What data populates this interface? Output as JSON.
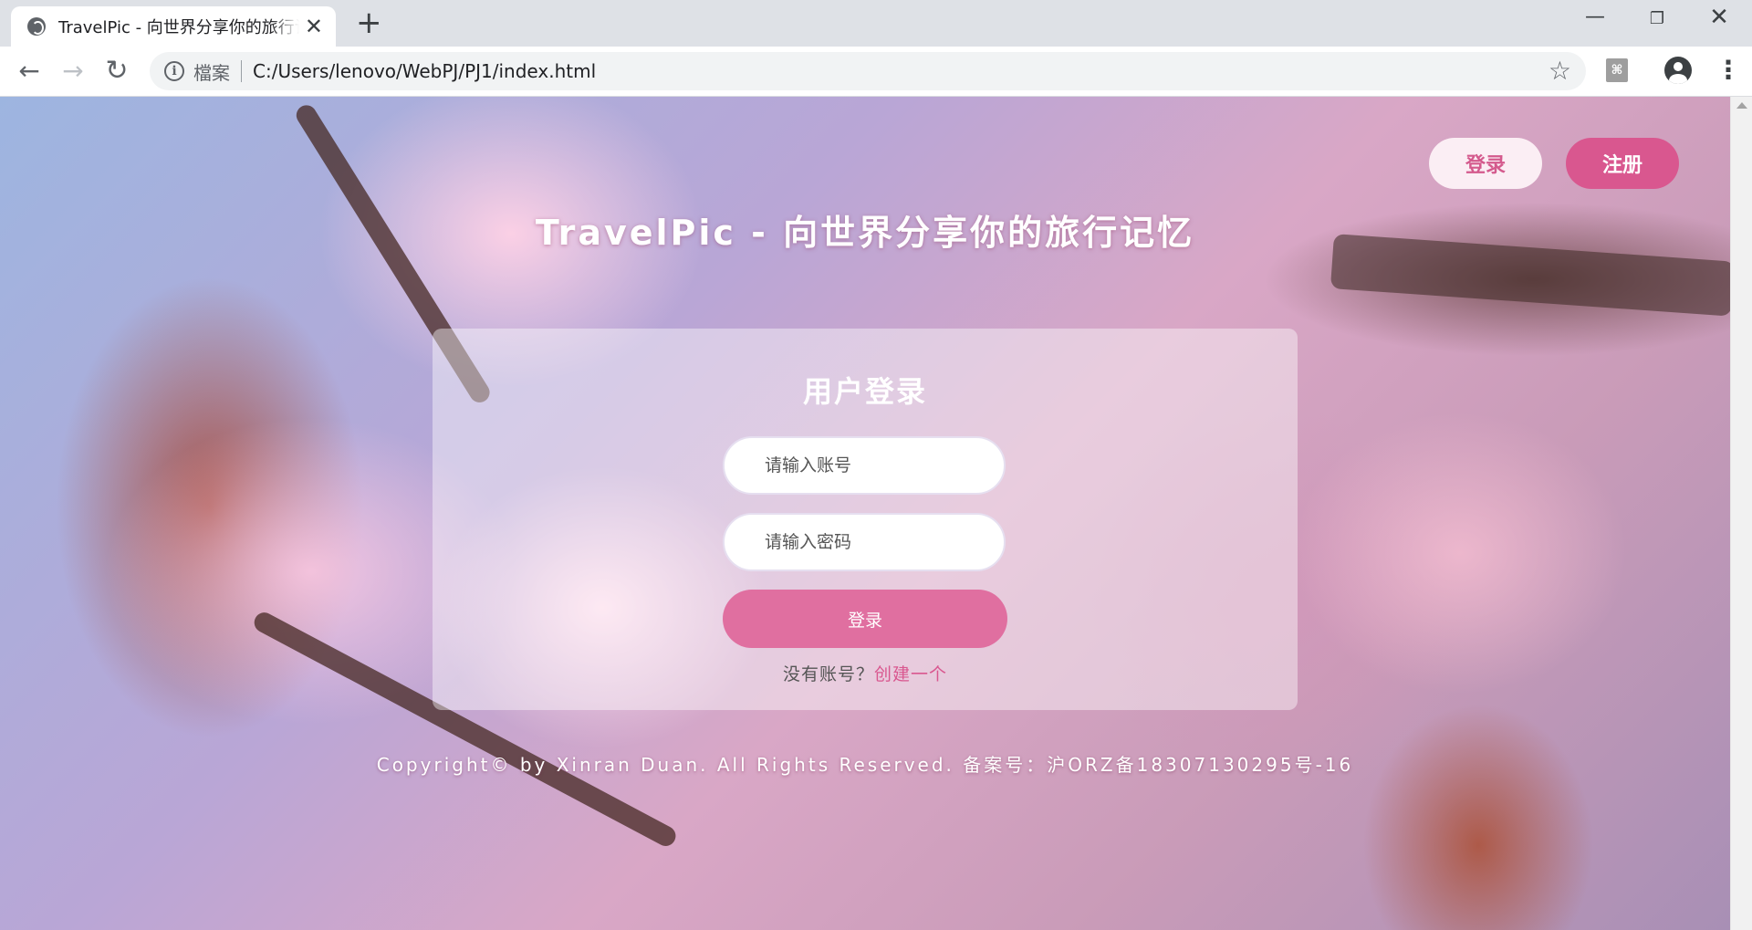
{
  "browser": {
    "tab_title": "TravelPic - 向世界分享你的旅行记忆",
    "tab_close": "✕",
    "new_tab": "+",
    "window_minimize": "—",
    "window_restore": "❐",
    "window_close": "✕",
    "back": "←",
    "forward": "→",
    "reload": "↻",
    "security_label": "檔案",
    "url": "C:/Users/lenovo/WebPJ/PJ1/index.html",
    "bookmark_star": "☆",
    "extension_icon": "pdf-extension-icon",
    "menu": "⋮"
  },
  "header": {
    "login_label": "登录",
    "register_label": "注册"
  },
  "site_title": "TravelPic - 向世界分享你的旅行记忆",
  "login_form": {
    "title": "用户登录",
    "username_placeholder": "请输入账号",
    "password_placeholder": "请输入密码",
    "submit_label": "登录",
    "no_account_text": "没有账号？",
    "create_link": "创建一个"
  },
  "footer": {
    "text": "Copyright© by Xinran Duan. All Rights Reserved. 备案号：沪ORZ备18307130295号-16"
  },
  "colors": {
    "accent_pink": "#d9578f",
    "button_pink": "#e06fa0",
    "chrome_bg": "#dee1e6"
  }
}
